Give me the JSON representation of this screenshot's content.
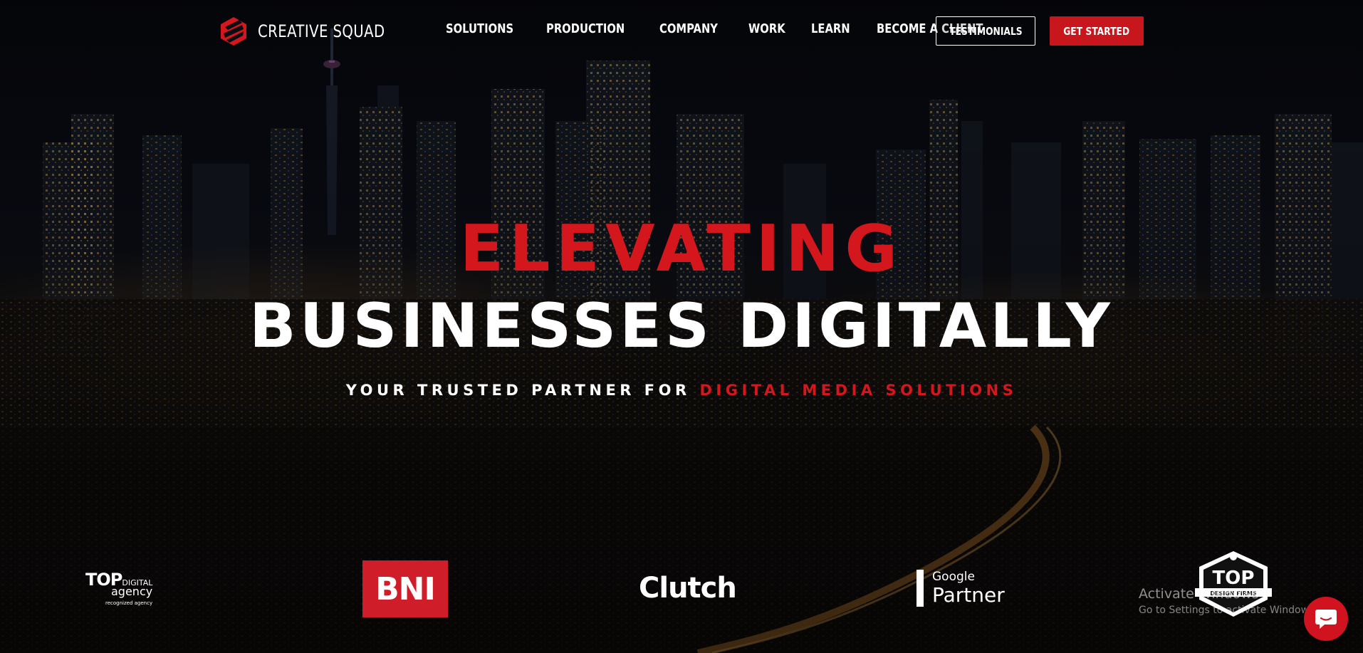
{
  "brand": {
    "name": "CREATIVE SQUAD",
    "accent": "#d4161d"
  },
  "nav": {
    "items": [
      "SOLUTIONS",
      "PRODUCTION",
      "COMPANY",
      "WORK",
      "LEARN",
      "BECOME A CLIENT"
    ]
  },
  "buttons": {
    "testimonials": "TESTIMONIALS",
    "get_started": "GET STARTED"
  },
  "hero": {
    "line1": "ELEVATING",
    "line2": "BUSINESSES DIGITALLY",
    "subtitle_white": "YOUR TRUSTED PARTNER FOR ",
    "subtitle_red": "DIGITAL MEDIA SOLUTIONS"
  },
  "partners": {
    "top_digital": {
      "main": "TOP",
      "sup": "DIGITAL",
      "agency": "agency",
      "small": "recognized agency"
    },
    "bni": "BNI",
    "clutch": "Clutch",
    "google": {
      "small": "Google",
      "big": "Partner"
    },
    "top_design": {
      "main": "TOP",
      "sub": "DESIGN FIRMS"
    }
  },
  "watermark": {
    "line1": "Activate Windows",
    "line2": "Go to Settings to activate Windows."
  },
  "icons": {
    "logo": "creative-squad-logo-icon",
    "chat": "chat-bubble-icon"
  }
}
